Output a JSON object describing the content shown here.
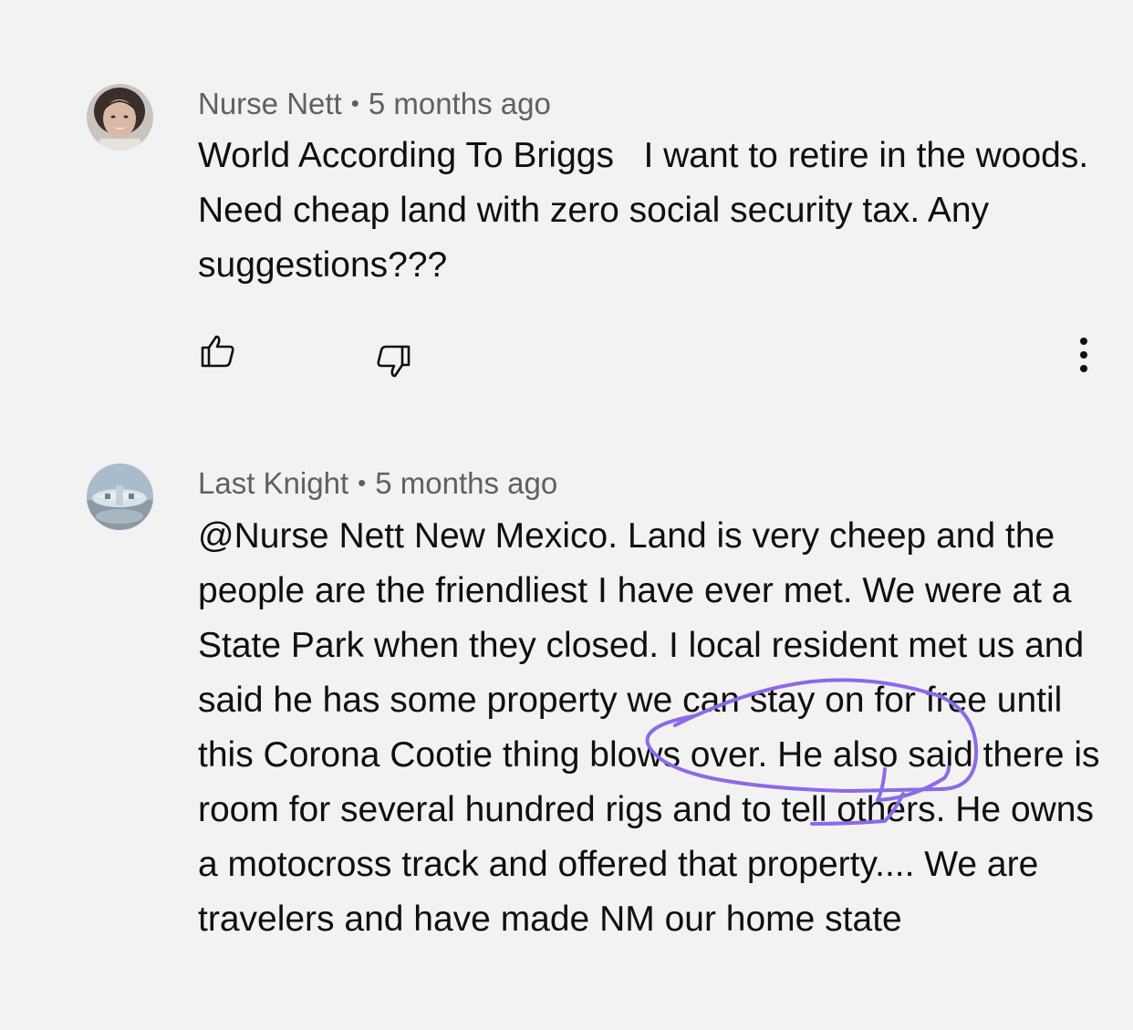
{
  "comments": [
    {
      "author": "Nurse Nett",
      "separator": "•",
      "time": "5 months ago",
      "text": "World According To Briggs   I want to retire in the woods. Need cheap land with zero social security tax. Any suggestions???",
      "avatar_icon": "user-avatar-woman"
    },
    {
      "author": "Last Knight",
      "separator": "•",
      "time": "5 months ago",
      "text": "@Nurse Nett New Mexico. Land is very cheep and the people are the friendliest I have ever met. We were at a State Park when they closed. I local resident met us and said he has some property we can stay on for free until this Corona Cootie thing blows over. He also said there is room for several hundred rigs and to tell others. He owns a motocross track and offered that property.... We are travelers and have made NM our home state",
      "avatar_icon": "user-avatar-aircraft"
    }
  ],
  "actions": {
    "like_icon": "thumbs-up-icon",
    "dislike_icon": "thumbs-down-icon",
    "more_icon": "more-vertical-icon"
  },
  "colors": {
    "background": "#f2f2f2",
    "text": "#0f0f0f",
    "meta": "#606060",
    "annotation": "#8b6ae6"
  }
}
